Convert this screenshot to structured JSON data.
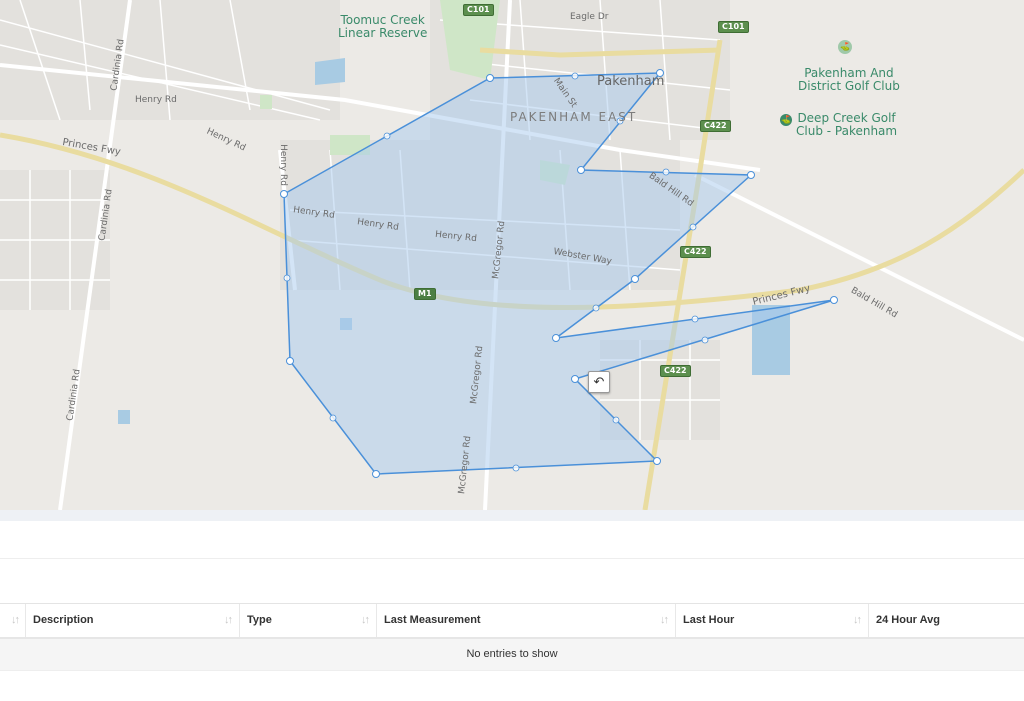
{
  "map": {
    "labels": {
      "toomuc": "Toomuc Creek\nLinear Reserve",
      "pakenham": "Pakenham",
      "pakenham_east": "PAKENHAM EAST",
      "golf1": "Pakenham And\nDistrict Golf Club",
      "golf2": "Deep Creek Golf\nClub - Pakenham",
      "eagle_dr": "Eagle Dr",
      "main_st": "Main St",
      "henry_rd": "Henry Rd",
      "cardinia_rd": "Cardinia Rd",
      "princes_fwy": "Princes Fwy",
      "bald_hill_rd": "Bald Hill Rd",
      "mcgregor_rd": "McGregor Rd",
      "webster_way": "Webster Way",
      "c101": "C101",
      "c422": "C422",
      "m1": "M1"
    },
    "undo_icon": "↶"
  },
  "table": {
    "columns": [
      {
        "label": ""
      },
      {
        "label": "Description"
      },
      {
        "label": "Type"
      },
      {
        "label": "Last Measurement"
      },
      {
        "label": "Last Hour"
      },
      {
        "label": "24 Hour Avg"
      }
    ],
    "sort_icon": "↓↑",
    "empty_message": "No entries to show"
  },
  "colors": {
    "polygon_fill": "#a7c9ee",
    "polygon_stroke": "#4a90d9",
    "freeway": "#e9dca0",
    "water": "#a8cbe3",
    "park": "#cfe6c7"
  }
}
